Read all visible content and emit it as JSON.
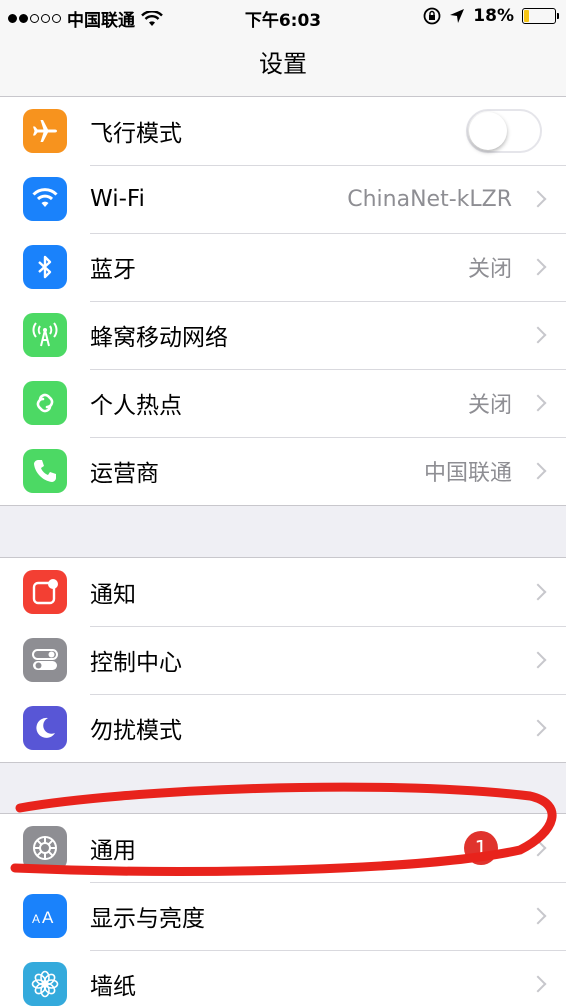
{
  "status_bar": {
    "carrier": "中国联通",
    "time": "下午6:03",
    "battery": "18%",
    "battery_level": 0.18
  },
  "nav": {
    "title": "设置"
  },
  "groups": [
    [
      {
        "label": "飞行模式",
        "icon": "airplane-icon",
        "color": "#f7931e",
        "toggle": false
      },
      {
        "label": "Wi-Fi",
        "icon": "wifi-icon",
        "color": "#1a82fb",
        "value": "ChinaNet-kLZR"
      },
      {
        "label": "蓝牙",
        "icon": "bluetooth-icon",
        "color": "#1a82fb",
        "value": "关闭"
      },
      {
        "label": "蜂窝移动网络",
        "icon": "cellular-icon",
        "color": "#4cd964"
      },
      {
        "label": "个人热点",
        "icon": "hotspot-icon",
        "color": "#4cd964",
        "value": "关闭"
      },
      {
        "label": "运营商",
        "icon": "phone-icon",
        "color": "#4cd964",
        "value": "中国联通"
      }
    ],
    [
      {
        "label": "通知",
        "icon": "notifications-icon",
        "color": "#f33f33"
      },
      {
        "label": "控制中心",
        "icon": "control-center-icon",
        "color": "#8e8e93"
      },
      {
        "label": "勿扰模式",
        "icon": "moon-icon",
        "color": "#5856d6"
      }
    ],
    [
      {
        "label": "通用",
        "icon": "gear-icon",
        "color": "#8e8e93",
        "badge": "1"
      },
      {
        "label": "显示与亮度",
        "icon": "display-icon",
        "color": "#1a82fb"
      },
      {
        "label": "墙纸",
        "icon": "wallpaper-icon",
        "color": "#34aadc"
      }
    ]
  ],
  "annotation_color": "#e8231c"
}
